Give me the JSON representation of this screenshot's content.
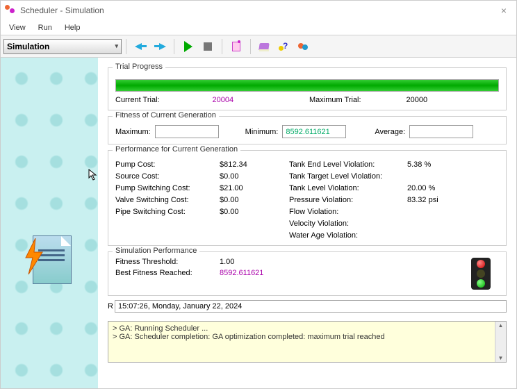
{
  "window": {
    "title": "Scheduler - Simulation"
  },
  "menu": {
    "view": "View",
    "run": "Run",
    "help": "Help"
  },
  "toolbar": {
    "mode": "Simulation"
  },
  "trial_progress": {
    "title": "Trial Progress",
    "current_label": "Current Trial:",
    "current_value": "20004",
    "max_label": "Maximum Trial:",
    "max_value": "20000"
  },
  "fitness": {
    "title": "Fitness of Current Generation",
    "max_label": "Maximum:",
    "max_value": "",
    "min_label": "Minimum:",
    "min_value": "8592.611621",
    "avg_label": "Average:",
    "avg_value": ""
  },
  "perf": {
    "title": "Performance for Current Generation",
    "pump_cost_l": "Pump Cost:",
    "pump_cost_v": "$812.34",
    "source_cost_l": "Source Cost:",
    "source_cost_v": "$0.00",
    "pump_sw_l": "Pump Switching Cost:",
    "pump_sw_v": "$21.00",
    "valve_sw_l": "Valve Switching Cost:",
    "valve_sw_v": "$0.00",
    "pipe_sw_l": "Pipe Switching Cost:",
    "pipe_sw_v": "$0.00",
    "tank_end_l": "Tank End Level Violation:",
    "tank_end_v": "5.38 %",
    "tank_tgt_l": "Tank Target Level Violation:",
    "tank_tgt_v": "",
    "tank_lvl_l": "Tank Level Violation:",
    "tank_lvl_v": "20.00 %",
    "pressure_l": "Pressure Violation:",
    "pressure_v": "83.32 psi",
    "flow_l": "Flow Violation:",
    "flow_v": "",
    "velocity_l": "Velocity Violation:",
    "velocity_v": "",
    "waterage_l": "Water Age Violation:",
    "waterage_v": ""
  },
  "simperf": {
    "title": "Simulation Performance",
    "thresh_l": "Fitness Threshold:",
    "thresh_v": "1.00",
    "best_l": "Best Fitness Reached:",
    "best_v": "8592.611621"
  },
  "timestamp": {
    "prefix": "R",
    "value": "15:07:26, Monday, January 22, 2024"
  },
  "log": {
    "line1": "GA: Running Scheduler ...",
    "line2": "GA: Scheduler completion: GA optimization completed: maximum trial reached"
  }
}
